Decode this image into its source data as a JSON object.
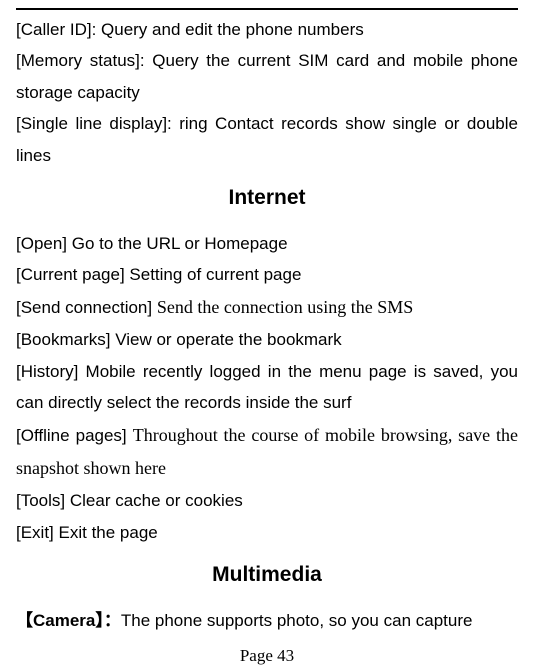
{
  "topSection": {
    "callerId": "[Caller ID]: Query and edit the phone numbers",
    "memoryStatus": "[Memory status]: Query the current SIM card and mobile phone storage capacity",
    "singleLine": "[Single line display]: ring Contact records show single or double lines"
  },
  "internet": {
    "heading": "Internet",
    "open": "[Open]   Go to the URL or Homepage",
    "currentPage": "[Current page] Setting of current page",
    "sendConnPrefix": "[Send connection] ",
    "sendConnText": "Send the connection using the SMS",
    "bookmarks": "[Bookmarks] View or operate the bookmark",
    "history": "[History] Mobile recently logged in the menu page is saved, you can directly select the records inside the surf",
    "offlinePrefix": "[Offline pages] ",
    "offlineText": "Throughout the course of mobile browsing, save the snapshot shown here",
    "tools": "[Tools] Clear cache or cookies",
    "exit": "[Exit] Exit the page"
  },
  "multimedia": {
    "heading": "Multimedia",
    "cameraLabel": "【Camera】：",
    "cameraText": "The phone supports photo, so you can capture"
  },
  "pageNumber": "Page 43"
}
